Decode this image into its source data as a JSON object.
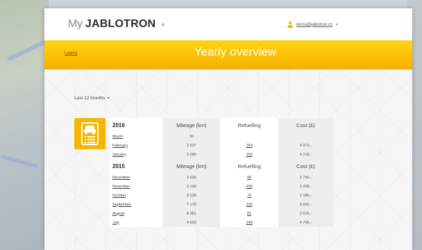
{
  "brand": {
    "prefix": "My",
    "name": "JABLOTRON",
    "caret": "▾"
  },
  "user": {
    "email": "demo@jablotron.cz",
    "caret": "▾",
    "icon": "user-icon"
  },
  "header": {
    "logout": "Logout",
    "title": "Yearly overview"
  },
  "filter": {
    "period": "Last 12 months",
    "caret": "▾"
  },
  "badge_icon": "car-document-icon",
  "colors": {
    "accent": "#fbbf00",
    "accent_dark": "#f3b000"
  },
  "sections": [
    {
      "year": "2016",
      "columns": {
        "mileage": "Mileage (km)",
        "refuelling": "Refuelling",
        "cost": "Cost (£)"
      },
      "rows": [
        {
          "month": "March",
          "mileage": "30",
          "refuelling": "",
          "cost": ""
        },
        {
          "month": "February",
          "mileage": "2 937",
          "refuelling": "163",
          "cost": "4 072,-"
        },
        {
          "month": "January",
          "mileage": "3 089",
          "refuelling": "152",
          "cost": "4 218,-"
        }
      ]
    },
    {
      "year": "2015",
      "columns": {
        "mileage": "Mileage (km)",
        "refuelling": "Refuelling",
        "cost": "Cost (£)"
      },
      "rows": [
        {
          "month": "December",
          "mileage": "3 696",
          "refuelling": "96",
          "cost": "2 756,-"
        },
        {
          "month": "November",
          "mileage": "3 196",
          "refuelling": "109",
          "cost": "3 288,-"
        },
        {
          "month": "October",
          "mileage": "3 038",
          "refuelling": "72",
          "cost": "2 185,-"
        },
        {
          "month": "September",
          "mileage": "7 178",
          "refuelling": "115",
          "cost": "3 695,-"
        },
        {
          "month": "August",
          "mileage": "8 381",
          "refuelling": "81",
          "cost": "2 625,-"
        },
        {
          "month": "July",
          "mileage": "4 093",
          "refuelling": "148",
          "cost": "4 706,-"
        }
      ]
    }
  ]
}
